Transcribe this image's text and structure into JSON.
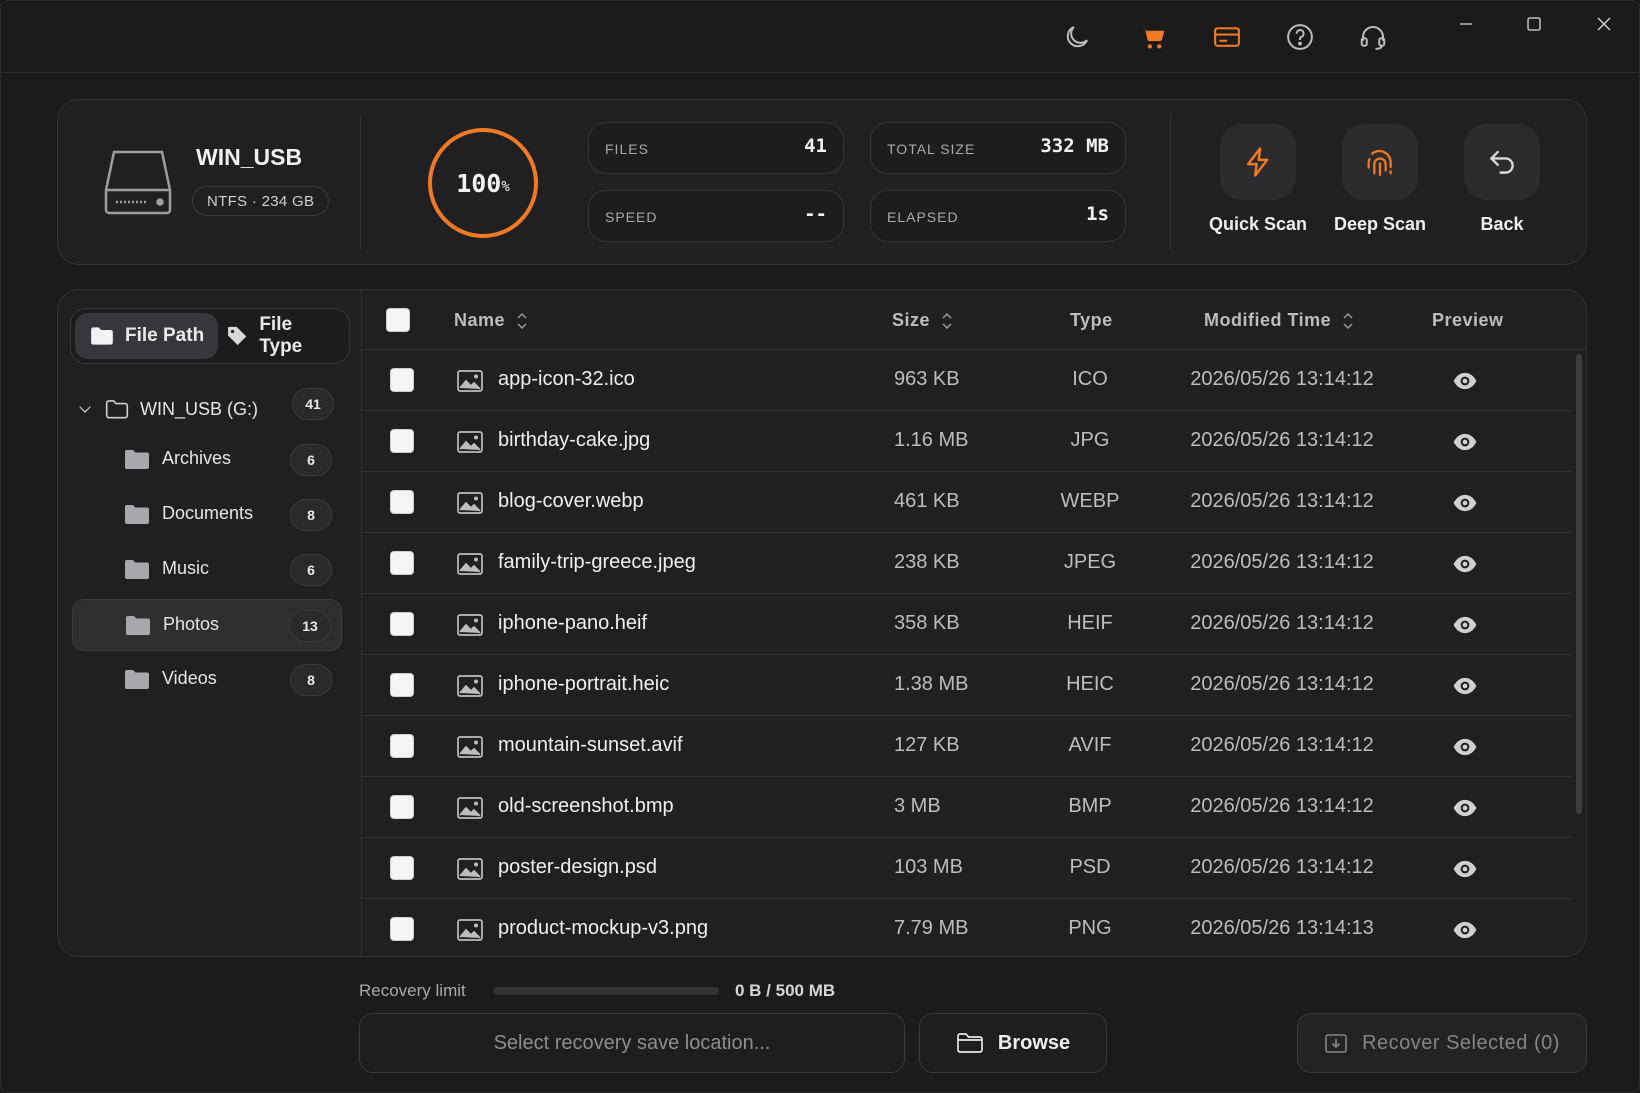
{
  "colors": {
    "accent": "#f07a24",
    "background": "#1b1b1c",
    "panel": "#202022"
  },
  "titlebar": {
    "icons": [
      "moon-icon",
      "cart-icon",
      "card-icon",
      "help-icon",
      "headset-icon"
    ],
    "window_controls": [
      "minimize-icon",
      "maximize-icon",
      "close-icon"
    ]
  },
  "drive": {
    "name": "WIN_USB",
    "fs_info": "NTFS · 234 GB"
  },
  "progress": {
    "percent_value": 100,
    "number": "100",
    "suffix": "%"
  },
  "stats": {
    "files_label": "FILES",
    "files_value": "41",
    "size_label": "TOTAL SIZE",
    "size_value": "332 MB",
    "speed_label": "SPEED",
    "speed_value": "--",
    "elapsed_label": "ELAPSED",
    "elapsed_value": "1s"
  },
  "actions": {
    "quick_scan": "Quick Scan",
    "deep_scan": "Deep Scan",
    "back": "Back"
  },
  "sidebar": {
    "tab_path": "File Path",
    "tab_type": "File Type",
    "root": {
      "label": "WIN_USB (G:)",
      "count": "41"
    },
    "items": [
      {
        "label": "Archives",
        "count": "6"
      },
      {
        "label": "Documents",
        "count": "8"
      },
      {
        "label": "Music",
        "count": "6"
      },
      {
        "label": "Photos",
        "count": "13"
      },
      {
        "label": "Videos",
        "count": "8"
      }
    ],
    "active_item": "Photos"
  },
  "table": {
    "headers": {
      "name": "Name",
      "size": "Size",
      "type": "Type",
      "modified": "Modified Time",
      "preview": "Preview"
    },
    "rows": [
      {
        "name": "app-icon-32.ico",
        "size": "963 KB",
        "type": "ICO",
        "time": "2026/05/26 13:14:12"
      },
      {
        "name": "birthday-cake.jpg",
        "size": "1.16 MB",
        "type": "JPG",
        "time": "2026/05/26 13:14:12"
      },
      {
        "name": "blog-cover.webp",
        "size": "461 KB",
        "type": "WEBP",
        "time": "2026/05/26 13:14:12"
      },
      {
        "name": "family-trip-greece.jpeg",
        "size": "238 KB",
        "type": "JPEG",
        "time": "2026/05/26 13:14:12"
      },
      {
        "name": "iphone-pano.heif",
        "size": "358 KB",
        "type": "HEIF",
        "time": "2026/05/26 13:14:12"
      },
      {
        "name": "iphone-portrait.heic",
        "size": "1.38 MB",
        "type": "HEIC",
        "time": "2026/05/26 13:14:12"
      },
      {
        "name": "mountain-sunset.avif",
        "size": "127 KB",
        "type": "AVIF",
        "time": "2026/05/26 13:14:12"
      },
      {
        "name": "old-screenshot.bmp",
        "size": "3 MB",
        "type": "BMP",
        "time": "2026/05/26 13:14:12"
      },
      {
        "name": "poster-design.psd",
        "size": "103 MB",
        "type": "PSD",
        "time": "2026/05/26 13:14:12"
      },
      {
        "name": "product-mockup-v3.png",
        "size": "7.79 MB",
        "type": "PNG",
        "time": "2026/05/26 13:14:13"
      }
    ]
  },
  "footer": {
    "recovery_label": "Recovery limit",
    "recovery_value": "0 B / 500 MB",
    "recovery_fraction": 0,
    "save_placeholder": "Select recovery save location...",
    "browse_label": "Browse",
    "recover_label": "Recover Selected (0)"
  }
}
